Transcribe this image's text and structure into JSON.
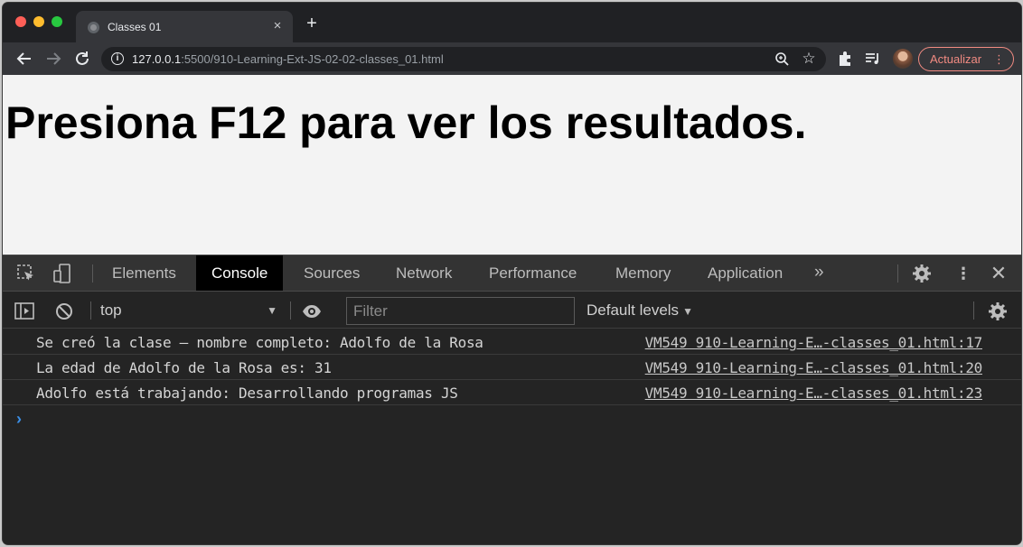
{
  "browser": {
    "tab": {
      "title": "Classes 01",
      "close": "×"
    },
    "new_tab": "+",
    "url_host": "127.0.0.1",
    "url_rest": ":5500/910-Learning-Ext-JS-02-02-classes_01.html",
    "update_label": "Actualizar",
    "menu_dots": "⋮"
  },
  "page": {
    "heading": "Presiona F12 para ver los resultados."
  },
  "devtools": {
    "tabs": [
      "Elements",
      "Console",
      "Sources",
      "Network",
      "Performance",
      "Memory",
      "Application"
    ],
    "active_tab": "Console",
    "more": "»",
    "kebab": "⋮",
    "close": "✕",
    "context": "top",
    "filter_placeholder": "Filter",
    "levels": "Default levels",
    "messages": [
      {
        "text": "Se creó la clase – nombre completo: Adolfo de la Rosa",
        "source": "VM549 910-Learning-E…-classes_01.html:17"
      },
      {
        "text": "La edad de Adolfo de la Rosa es: 31",
        "source": "VM549 910-Learning-E…-classes_01.html:20"
      },
      {
        "text": "Adolfo está trabajando: Desarrollando programas JS",
        "source": "VM549 910-Learning-E…-classes_01.html:23"
      }
    ],
    "prompt": "›"
  },
  "colors": {
    "accent_update": "#f28b82",
    "prompt": "#3b8fe6",
    "active_tab_bg": "#000000"
  }
}
